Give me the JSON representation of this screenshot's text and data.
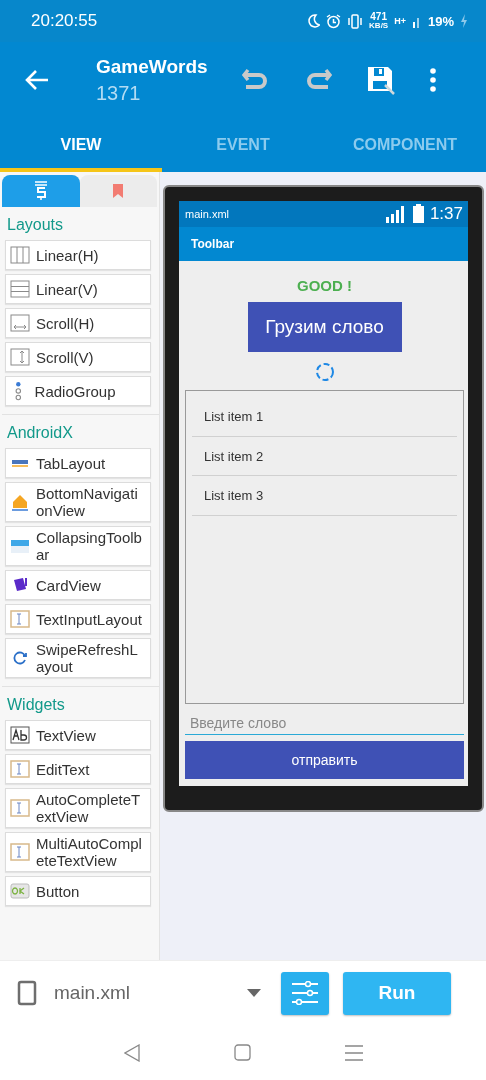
{
  "status_bar": {
    "time": "20:20:55",
    "speed": "471",
    "speed_unit": "KB/S",
    "network": "H+",
    "battery": "19%",
    "charging": true
  },
  "app_bar": {
    "title": "GameWords",
    "subtitle": "1371"
  },
  "tabs": [
    {
      "label": "VIEW",
      "selected": true
    },
    {
      "label": "EVENT",
      "selected": false
    },
    {
      "label": "COMPONENT",
      "selected": false
    }
  ],
  "palette": {
    "tabs": [
      {
        "selected": true
      },
      {
        "selected": false
      }
    ],
    "sections": [
      {
        "title": "Layouts",
        "items": [
          "Linear(H)",
          "Linear(V)",
          "Scroll(H)",
          "Scroll(V)",
          "RadioGroup"
        ]
      },
      {
        "title": "AndroidX",
        "items": [
          "TabLayout",
          "BottomNavigationView",
          "CollapsingToolbar",
          "CardView",
          "TextInputLayout",
          "SwipeRefreshLayout"
        ]
      },
      {
        "title": "Widgets",
        "items": [
          "TextView",
          "EditText",
          "AutoCompleteTextView",
          "MultiAutoCompleteTextView",
          "Button"
        ]
      }
    ]
  },
  "preview": {
    "file": "main.xml",
    "time": "1:37",
    "toolbar": "Toolbar",
    "status_text": "GOOD !",
    "word_button": "Грузим слово",
    "list_items": [
      "List item 1",
      "List item 2",
      "List item 3"
    ],
    "input": {
      "placeholder": "Введите слово"
    },
    "send_button": "отправить"
  },
  "bottom_bar": {
    "file": "main.xml",
    "run_button": "Run"
  }
}
